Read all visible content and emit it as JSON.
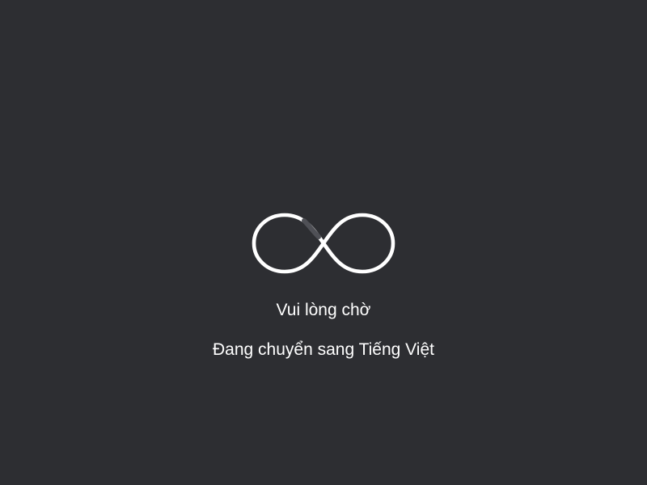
{
  "loader": {
    "icon": "infinity-loader-icon",
    "stroke_color": "#ffffff",
    "track_color": "#4f5056"
  },
  "message": {
    "wait": "Vui lòng chờ",
    "status": "Đang chuyển sang Tiếng Việt"
  },
  "colors": {
    "background": "#2d2e32",
    "text": "#ffffff"
  }
}
